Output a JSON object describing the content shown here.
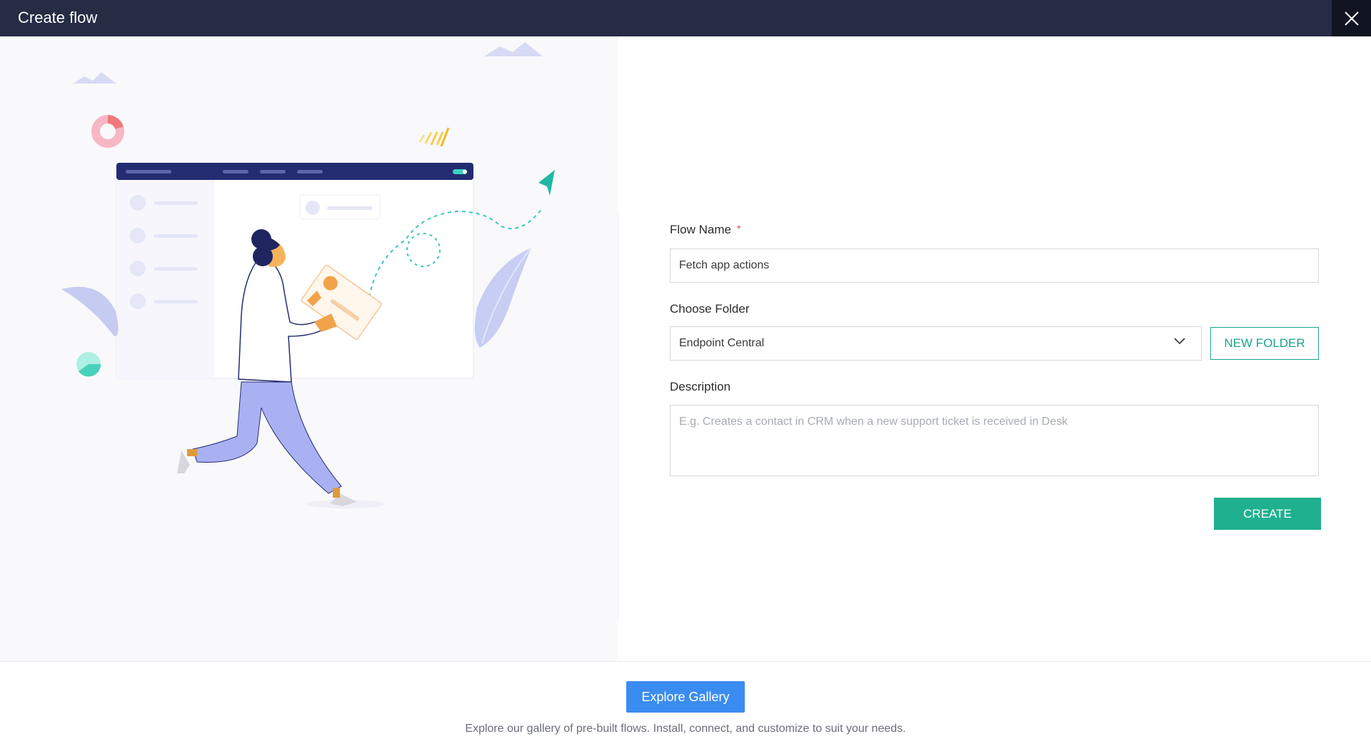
{
  "header": {
    "title": "Create flow"
  },
  "form": {
    "flow_name_label": "Flow Name",
    "required_marker": "*",
    "flow_name_value": "Fetch app actions",
    "folder_label": "Choose Folder",
    "folder_value": "Endpoint Central",
    "new_folder_label": "NEW FOLDER",
    "description_label": "Description",
    "description_placeholder": "E.g. Creates a contact in CRM when a new support ticket is received in Desk",
    "create_label": "CREATE"
  },
  "footer": {
    "explore_label": "Explore Gallery",
    "explore_text": "Explore our gallery of pre-built flows. Install, connect, and customize to suit your needs."
  },
  "colors": {
    "header_bg": "#252c44",
    "accent": "#1fb08f",
    "explore_button": "#3b8cf0",
    "required": "#e54040"
  }
}
